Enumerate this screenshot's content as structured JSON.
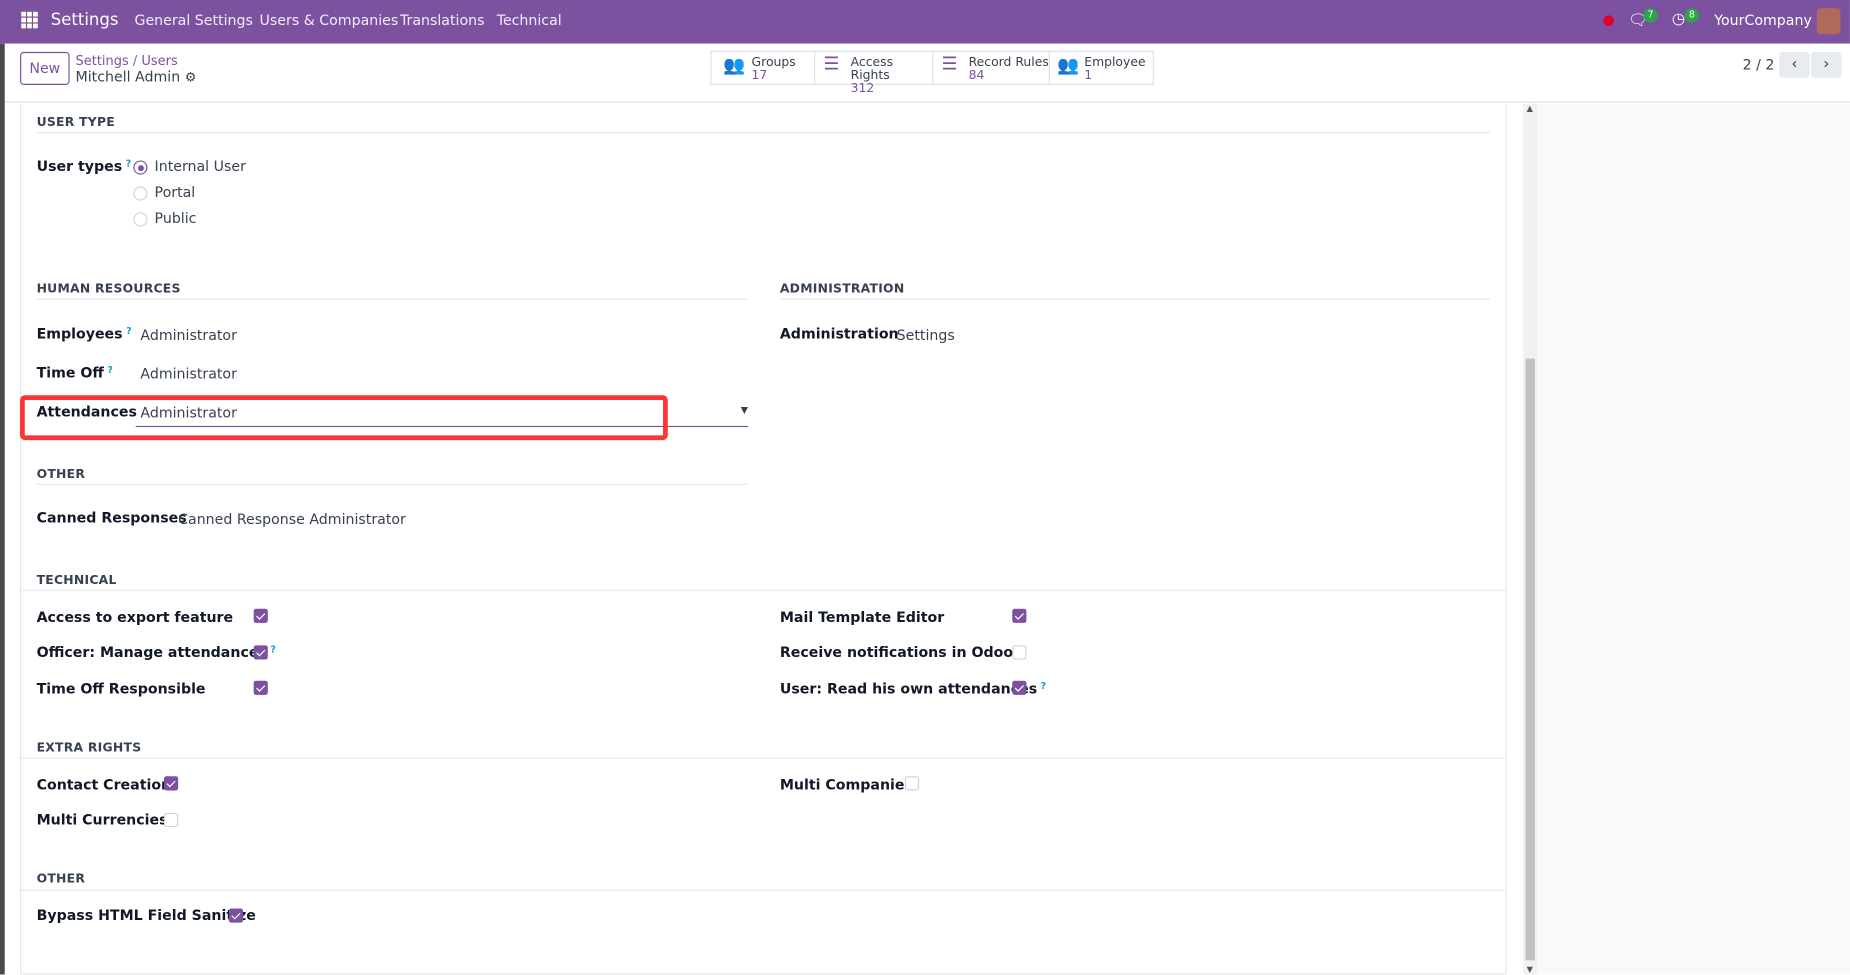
{
  "topbar": {
    "app": "Settings",
    "menu": [
      "General Settings",
      "Users & Companies",
      "Translations",
      "Technical"
    ],
    "chat_badge": "7",
    "activity_badge": "8",
    "company": "YourCompany"
  },
  "control": {
    "new_label": "New",
    "breadcrumb": [
      "Settings",
      "Users"
    ],
    "record": "Mitchell Admin",
    "stats": [
      {
        "label": "Groups",
        "value": "17"
      },
      {
        "label": "Access Rights",
        "value": "312"
      },
      {
        "label": "Record Rules",
        "value": "84"
      },
      {
        "label": "Employee",
        "value": "1"
      }
    ],
    "pager": "2 / 2"
  },
  "user_type": {
    "title": "USER TYPE",
    "label": "User types",
    "options": [
      "Internal User",
      "Portal",
      "Public"
    ],
    "selected": "Internal User"
  },
  "hr": {
    "title": "HUMAN RESOURCES",
    "fields": [
      {
        "label": "Employees",
        "value": "Administrator"
      },
      {
        "label": "Time Off",
        "value": "Administrator"
      },
      {
        "label": "Attendances",
        "value": "Administrator"
      }
    ]
  },
  "admin": {
    "title": "ADMINISTRATION",
    "label": "Administration",
    "value": "Settings"
  },
  "other": {
    "title": "OTHER",
    "label": "Canned Responses",
    "value": "Canned Response Administrator"
  },
  "technical": {
    "title": "TECHNICAL",
    "left": [
      {
        "label": "Access to export feature",
        "checked": true
      },
      {
        "label": "Officer: Manage attendances",
        "checked": true
      },
      {
        "label": "Time Off Responsible",
        "checked": true
      }
    ],
    "right": [
      {
        "label": "Mail Template Editor",
        "checked": true
      },
      {
        "label": "Receive notifications in Odoo",
        "checked": false
      },
      {
        "label": "User: Read his own attendances",
        "checked": true
      }
    ]
  },
  "extra": {
    "title": "EXTRA RIGHTS",
    "items": [
      {
        "label": "Contact Creation",
        "checked": true
      },
      {
        "label": "Multi Currencies",
        "checked": false
      },
      {
        "label": "Multi Companies",
        "checked": false
      }
    ]
  },
  "other2": {
    "title": "OTHER",
    "label": "Bypass HTML Field Sanitize",
    "checked": true
  },
  "colors": {
    "brand": "#7c519f",
    "highlight": "#ff3333"
  }
}
